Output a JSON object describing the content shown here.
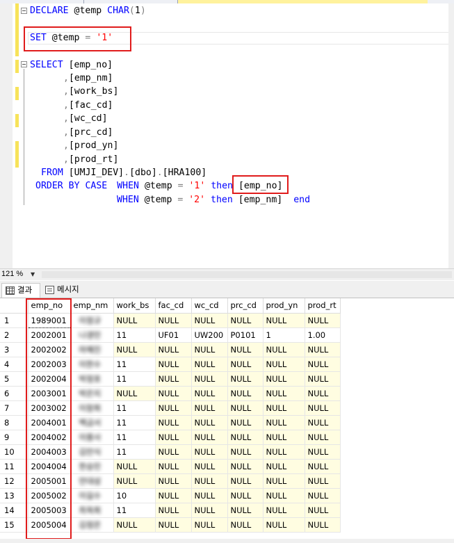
{
  "editor": {
    "lines": {
      "declare": {
        "kw1": "DECLARE",
        "var": " @temp ",
        "kw2": "CHAR",
        "paren_open": "(",
        "num": "1",
        "paren_close": ")"
      },
      "set": {
        "kw": "SET",
        "var": " @temp ",
        "op": "=",
        "sp": " ",
        "str": "'1'"
      },
      "select": {
        "kw": "SELECT",
        "col": " [emp_no]"
      },
      "cols": [
        {
          "comma": ",",
          "name": "[emp_nm]"
        },
        {
          "comma": ",",
          "name": "[work_bs]"
        },
        {
          "comma": ",",
          "name": "[fac_cd]"
        },
        {
          "comma": ",",
          "name": "[wc_cd]"
        },
        {
          "comma": ",",
          "name": "[prc_cd]"
        },
        {
          "comma": ",",
          "name": "[prod_yn]"
        },
        {
          "comma": ",",
          "name": "[prod_rt]"
        }
      ],
      "from": {
        "kw": "FROM",
        "db": " [UMJI_DEV]",
        "dot1": ".",
        "schema": "[dbo]",
        "dot2": ".",
        "table": "[HRA100]"
      },
      "order": {
        "kw1": "ORDER BY",
        "kw2": " CASE",
        "kw3": "WHEN",
        "var": " @temp ",
        "op": "=",
        "str": " '1'",
        "kw4": " then",
        "col": " [emp_no]"
      },
      "when2": {
        "kw1": "WHEN",
        "var": " @temp ",
        "op": "=",
        "str": " '2'",
        "kw2": " then",
        "col": " [emp_nm]",
        "end": "end"
      }
    }
  },
  "zoom": {
    "value": "121 %"
  },
  "result_tabs": [
    {
      "label": "결과"
    },
    {
      "label": "메시지"
    }
  ],
  "grid": {
    "columns": [
      "emp_no",
      "emp_nm",
      "work_bs",
      "fac_cd",
      "wc_cd",
      "prc_cd",
      "prod_yn",
      "prod_rt"
    ],
    "rows": [
      {
        "n": "1",
        "emp_no": "1989001",
        "emp_nm": "이정규",
        "work_bs": "NULL",
        "fac_cd": "NULL",
        "wc_cd": "NULL",
        "prc_cd": "NULL",
        "prod_yn": "NULL",
        "prod_rt": "NULL"
      },
      {
        "n": "2",
        "emp_no": "2002001",
        "emp_nm": "나경민",
        "work_bs": "11",
        "fac_cd": "UF01",
        "wc_cd": "UW200",
        "prc_cd": "P0101",
        "prod_yn": "1",
        "prod_rt": "1.00"
      },
      {
        "n": "3",
        "emp_no": "2002002",
        "emp_nm": "마혜진",
        "work_bs": "NULL",
        "fac_cd": "NULL",
        "wc_cd": "NULL",
        "prc_cd": "NULL",
        "prod_yn": "NULL",
        "prod_rt": "NULL"
      },
      {
        "n": "4",
        "emp_no": "2002003",
        "emp_nm": "이한수",
        "work_bs": "11",
        "fac_cd": "NULL",
        "wc_cd": "NULL",
        "prc_cd": "NULL",
        "prod_yn": "NULL",
        "prod_rt": "NULL"
      },
      {
        "n": "5",
        "emp_no": "2002004",
        "emp_nm": "박정호",
        "work_bs": "11",
        "fac_cd": "NULL",
        "wc_cd": "NULL",
        "prc_cd": "NULL",
        "prod_yn": "NULL",
        "prod_rt": "NULL"
      },
      {
        "n": "6",
        "emp_no": "2003001",
        "emp_nm": "박은지",
        "work_bs": "NULL",
        "fac_cd": "NULL",
        "wc_cd": "NULL",
        "prc_cd": "NULL",
        "prod_yn": "NULL",
        "prod_rt": "NULL"
      },
      {
        "n": "7",
        "emp_no": "2003002",
        "emp_nm": "이창희",
        "work_bs": "11",
        "fac_cd": "NULL",
        "wc_cd": "NULL",
        "prc_cd": "NULL",
        "prod_yn": "NULL",
        "prod_rt": "NULL"
      },
      {
        "n": "8",
        "emp_no": "2004001",
        "emp_nm": "백금서",
        "work_bs": "11",
        "fac_cd": "NULL",
        "wc_cd": "NULL",
        "prc_cd": "NULL",
        "prod_yn": "NULL",
        "prod_rt": "NULL"
      },
      {
        "n": "9",
        "emp_no": "2004002",
        "emp_nm": "이용사",
        "work_bs": "11",
        "fac_cd": "NULL",
        "wc_cd": "NULL",
        "prc_cd": "NULL",
        "prod_yn": "NULL",
        "prod_rt": "NULL"
      },
      {
        "n": "10",
        "emp_no": "2004003",
        "emp_nm": "김만식",
        "work_bs": "11",
        "fac_cd": "NULL",
        "wc_cd": "NULL",
        "prc_cd": "NULL",
        "prod_yn": "NULL",
        "prod_rt": "NULL"
      },
      {
        "n": "11",
        "emp_no": "2004004",
        "emp_nm": "한승민",
        "work_bs": "NULL",
        "fac_cd": "NULL",
        "wc_cd": "NULL",
        "prc_cd": "NULL",
        "prod_yn": "NULL",
        "prod_rt": "NULL"
      },
      {
        "n": "12",
        "emp_no": "2005001",
        "emp_nm": "안대성",
        "work_bs": "NULL",
        "fac_cd": "NULL",
        "wc_cd": "NULL",
        "prc_cd": "NULL",
        "prod_yn": "NULL",
        "prod_rt": "NULL"
      },
      {
        "n": "13",
        "emp_no": "2005002",
        "emp_nm": "이길수",
        "work_bs": "10",
        "fac_cd": "NULL",
        "wc_cd": "NULL",
        "prc_cd": "NULL",
        "prod_yn": "NULL",
        "prod_rt": "NULL"
      },
      {
        "n": "14",
        "emp_no": "2005003",
        "emp_nm": "최옥희",
        "work_bs": "11",
        "fac_cd": "NULL",
        "wc_cd": "NULL",
        "prc_cd": "NULL",
        "prod_yn": "NULL",
        "prod_rt": "NULL"
      },
      {
        "n": "15",
        "emp_no": "2005004",
        "emp_nm": "김정은",
        "work_bs": "NULL",
        "fac_cd": "NULL",
        "wc_cd": "NULL",
        "prc_cd": "NULL",
        "prod_yn": "NULL",
        "prod_rt": "NULL"
      }
    ]
  },
  "colors": {
    "keyword": "#0000ff",
    "string": "#ff0000",
    "null_cell": "#fffde1",
    "highlight": "#e01b1b",
    "change_bar": "#f7e35a"
  }
}
